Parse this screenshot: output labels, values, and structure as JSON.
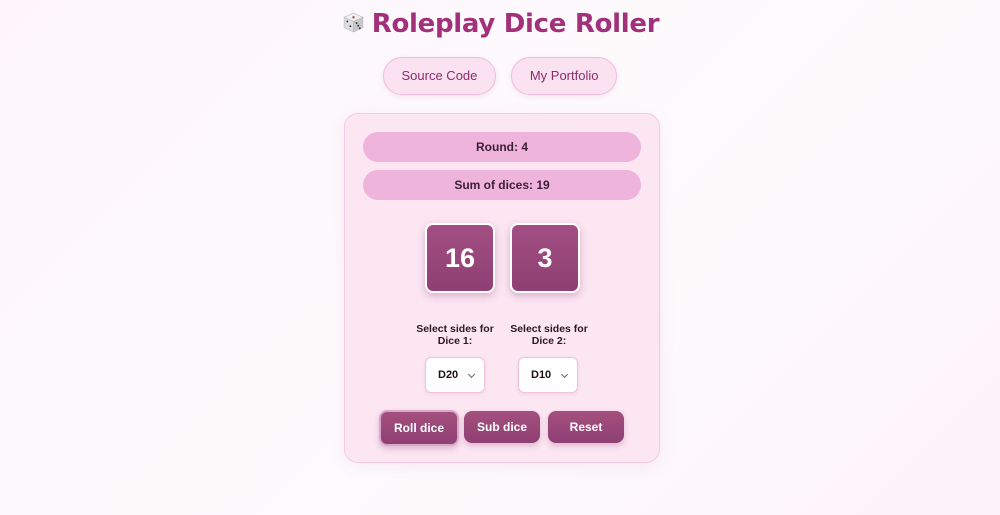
{
  "header": {
    "title": "Roleplay Dice Roller",
    "icon": "die-icon"
  },
  "links": {
    "source_code": "Source Code",
    "portfolio": "My Portfolio"
  },
  "stats": {
    "round": "Round: 4",
    "sum": "Sum of dices: 19"
  },
  "dice": [
    {
      "value": "16"
    },
    {
      "value": "3"
    }
  ],
  "selectors": [
    {
      "label": "Select sides for Dice 1:",
      "selected": "D20"
    },
    {
      "label": "Select sides for Dice 2:",
      "selected": "D10"
    }
  ],
  "actions": {
    "roll": "Roll dice",
    "sub": "Sub dice",
    "reset": "Reset"
  },
  "colors": {
    "accent": "#a2307a",
    "die_fill": "#97467a",
    "pill": "#eeb4dc",
    "card": "#fbe6f2"
  }
}
